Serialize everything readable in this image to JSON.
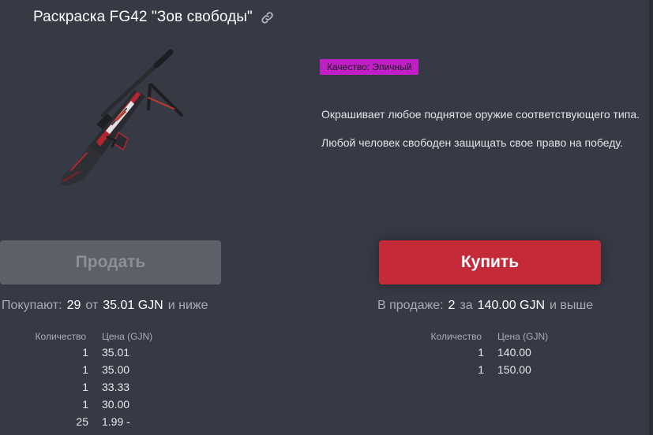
{
  "item": {
    "title": "Раскраска FG42 \"Зов свободы\"",
    "quality": "Качество: Эпичный",
    "quality_color": "#c01fc6",
    "description": [
      "Окрашивает любое поднятое оружие соответствующего типа.",
      "Любой человек свободен защищать свое право на победу."
    ]
  },
  "icons": {
    "link": "link-icon"
  },
  "actions": {
    "sell_label": "Продать",
    "buy_label": "Купить"
  },
  "buy_orders": {
    "prefix": "Покупают:",
    "count": "29",
    "from_word": "от",
    "price": "35.01 GJN",
    "suffix": "и ниже",
    "columns": {
      "qty": "Количество",
      "price": "Цена (GJN)"
    },
    "rows": [
      {
        "qty": "1",
        "price": "35.01"
      },
      {
        "qty": "1",
        "price": "35.00"
      },
      {
        "qty": "1",
        "price": "33.33"
      },
      {
        "qty": "1",
        "price": "30.00"
      },
      {
        "qty": "25",
        "price": "1.99 -"
      }
    ]
  },
  "sell_orders": {
    "prefix": "В продаже:",
    "count": "2",
    "from_word": "за",
    "price": "140.00 GJN",
    "suffix": "и выше",
    "columns": {
      "qty": "Количество",
      "price": "Цена (GJN)"
    },
    "rows": [
      {
        "qty": "1",
        "price": "140.00"
      },
      {
        "qty": "1",
        "price": "150.00"
      }
    ]
  },
  "colors": {
    "background": "#363a44",
    "buy_button": "#c42a37",
    "sell_button": "#5c6068"
  }
}
